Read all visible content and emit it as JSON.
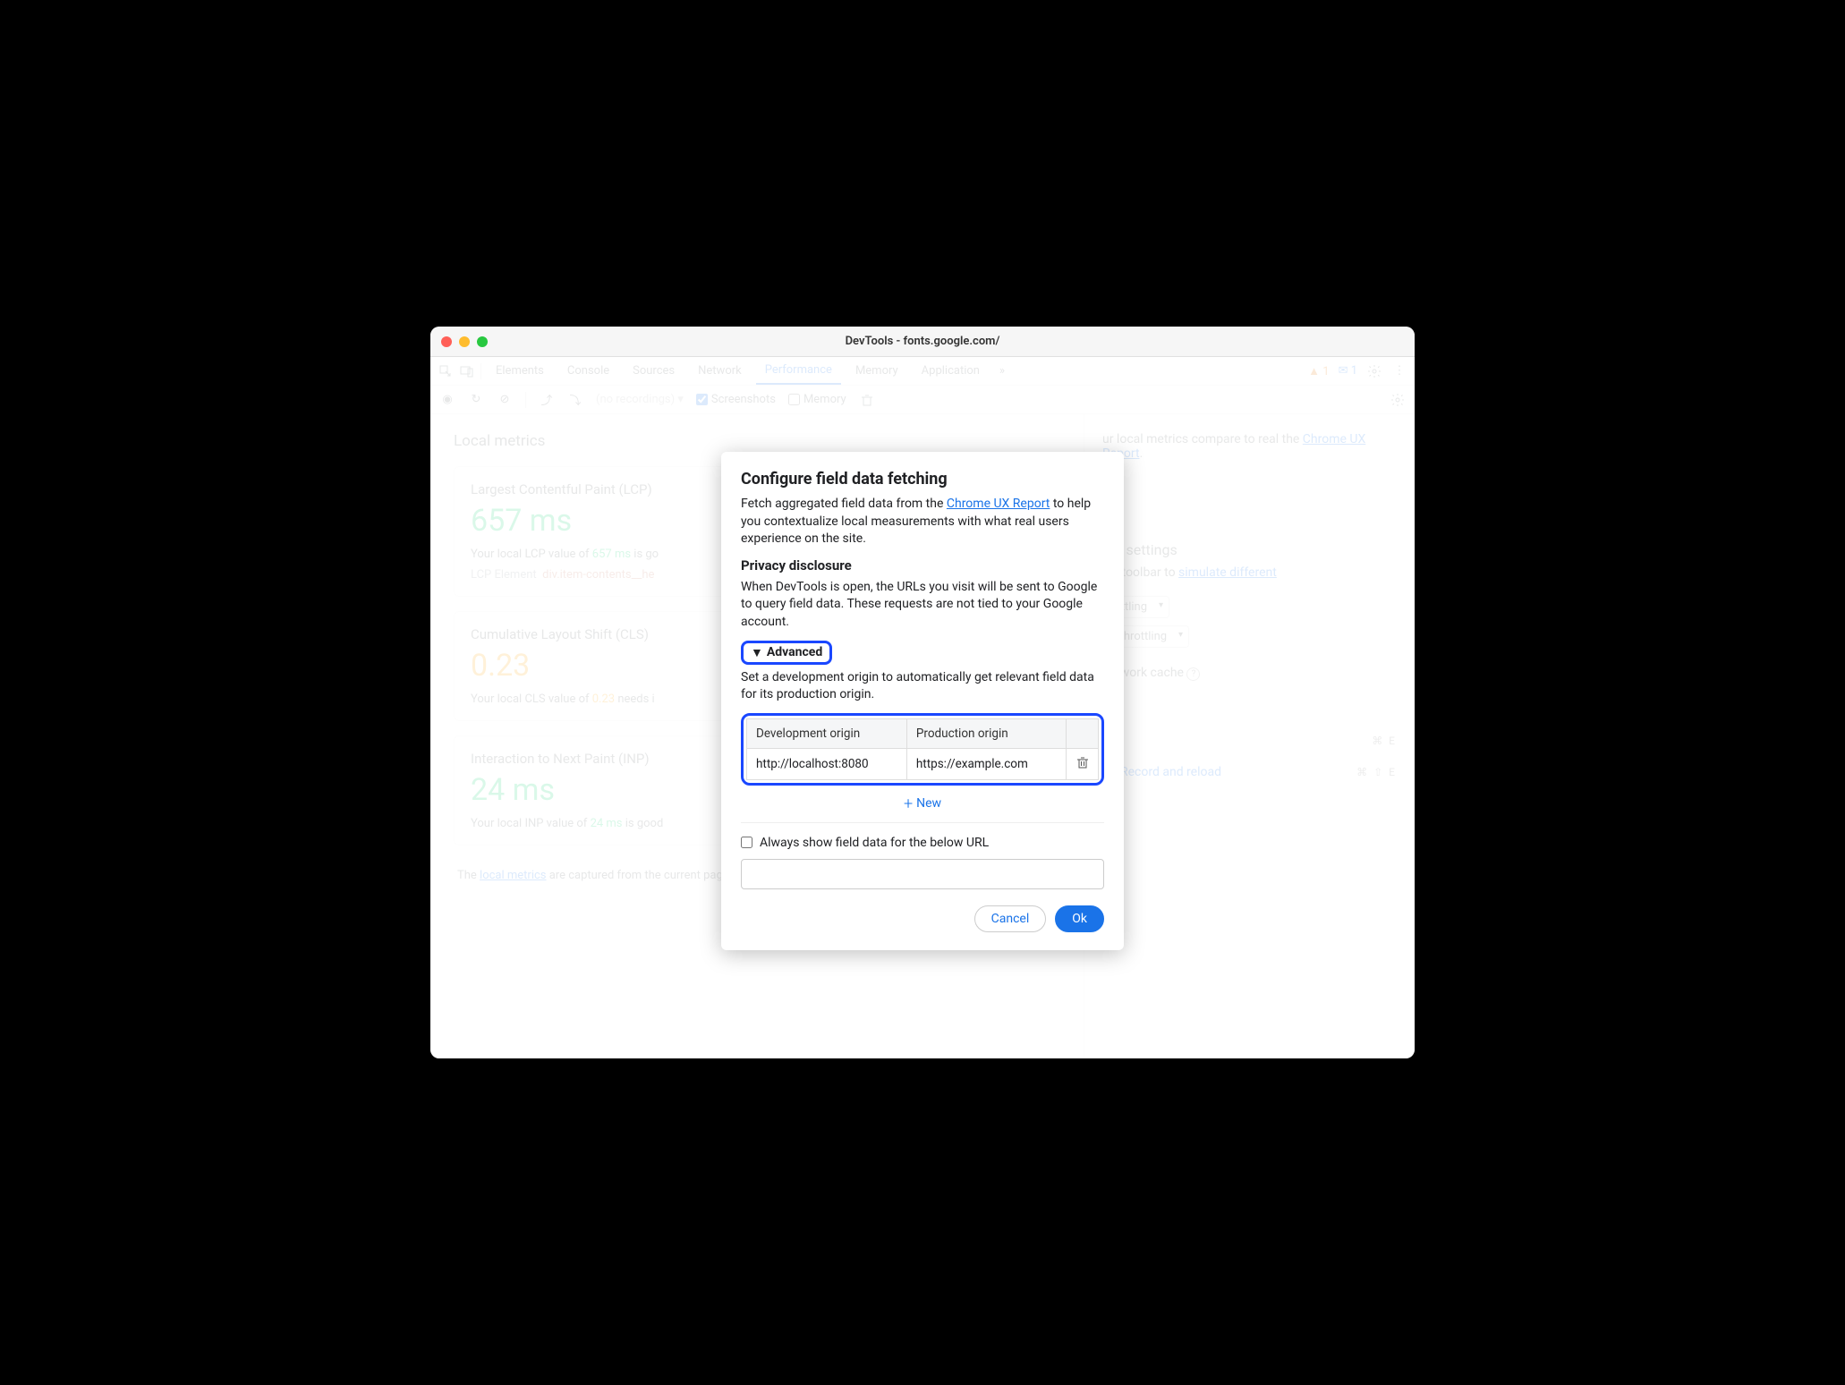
{
  "titlebar": {
    "title": "DevTools - fonts.google.com/"
  },
  "tabs": [
    "Elements",
    "Console",
    "Sources",
    "Network",
    "Performance",
    "Memory",
    "Application"
  ],
  "activeTab": "Performance",
  "badges": {
    "warn": "1",
    "msg": "1"
  },
  "subbar": {
    "norec": "(no recordings)",
    "screenshots": "Screenshots",
    "memory": "Memory"
  },
  "left": {
    "heading": "Local metrics",
    "lcp": {
      "name": "Largest Contentful Paint (LCP)",
      "value": "657 ms",
      "desc_pre": "Your local LCP value of ",
      "desc_val": "657 ms",
      "desc_post": " is go",
      "el_label": "LCP Element",
      "el_sel": "div.item-contents__he"
    },
    "cls": {
      "name": "Cumulative Layout Shift (CLS)",
      "value": "0.23",
      "desc_pre": "Your local CLS value of ",
      "desc_val": "0.23",
      "desc_post": " needs i"
    },
    "inp": {
      "name": "Interaction to Next Paint (INP)",
      "value": "24 ms",
      "desc_pre": "Your local INP value of ",
      "desc_val": "24 ms",
      "desc_post": " is good"
    },
    "footer_pre": "The ",
    "footer_link": "local metrics",
    "footer_post": " are captured from the current page using your network connection and device."
  },
  "right": {
    "compare_pre": "ur local metrics compare to real ",
    "compare_mid": " the ",
    "compare_link": "Chrome UX Report",
    "compare_post": ".",
    "env_title": "ent settings",
    "env_desc_pre": "ice toolbar to ",
    "env_link": "simulate different",
    "cpu_sel": "rottling",
    "net_sel": "o throttling",
    "cache_label": " network cache",
    "rec": "Record and reload",
    "kbd1": "⌘ E",
    "kbd2": "⌘ ⇧ E"
  },
  "modal": {
    "title": "Configure field data fetching",
    "p1_pre": "Fetch aggregated field data from the ",
    "p1_link": "Chrome UX Report",
    "p1_post": " to help you contextualize local measurements with what real users experience on the site.",
    "privacy_h": "Privacy disclosure",
    "privacy_p": "When DevTools is open, the URLs you visit will be sent to Google to query field data. These requests are not tied to your Google account.",
    "advanced": "Advanced",
    "adv_desc": "Set a development origin to automatically get relevant field data for its production origin.",
    "col1": "Development origin",
    "col2": "Production origin",
    "dev": "http://localhost:8080",
    "prod": "https://example.com",
    "new": "New",
    "always": "Always show field data for the below URL",
    "cancel": "Cancel",
    "ok": "Ok"
  }
}
